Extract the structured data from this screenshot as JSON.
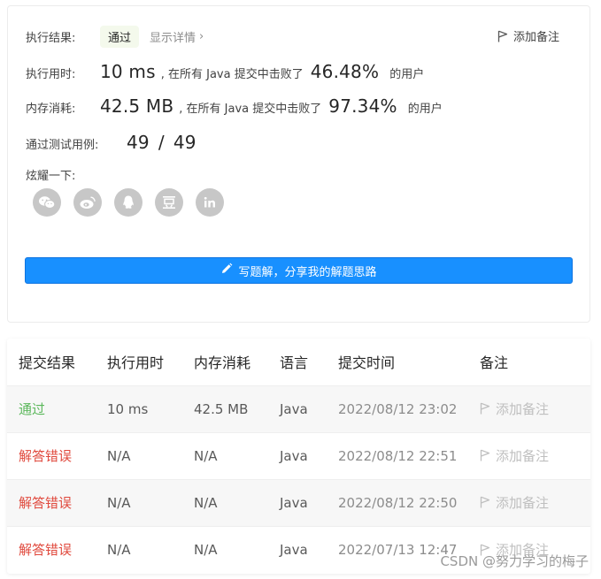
{
  "summary": {
    "result_label": "执行结果:",
    "result_value": "通过",
    "details_label": "显示详情",
    "details_chevron": "›",
    "add_note": "添加备注",
    "runtime": {
      "label": "执行用时:",
      "value": "10 ms",
      "mid": ", 在所有 Java 提交中击败了",
      "percent": "46.48%",
      "suffix": "的用户"
    },
    "memory": {
      "label": "内存消耗:",
      "value": "42.5 MB",
      "mid": ", 在所有 Java 提交中击败了",
      "percent": "97.34%",
      "suffix": "的用户"
    },
    "tests": {
      "label": "通过测试用例:",
      "passed": "49",
      "sep": "/",
      "total": "49"
    },
    "share_label": "炫耀一下:",
    "share_icons": [
      "wechat-icon",
      "weibo-icon",
      "qq-icon",
      "douban-icon",
      "linkedin-icon"
    ],
    "write_button": "写题解，分享我的解题思路"
  },
  "table": {
    "headers": [
      "提交结果",
      "执行用时",
      "内存消耗",
      "语言",
      "提交时间",
      "备注"
    ],
    "rows": [
      {
        "result": "通过",
        "status": "ok",
        "runtime": "10 ms",
        "memory": "42.5 MB",
        "lang": "Java",
        "time": "2022/08/12 23:02",
        "note": "添加备注"
      },
      {
        "result": "解答错误",
        "status": "err",
        "runtime": "N/A",
        "memory": "N/A",
        "lang": "Java",
        "time": "2022/08/12 22:51",
        "note": "添加备注"
      },
      {
        "result": "解答错误",
        "status": "err",
        "runtime": "N/A",
        "memory": "N/A",
        "lang": "Java",
        "time": "2022/08/12 22:50",
        "note": "添加备注"
      },
      {
        "result": "解答错误",
        "status": "err",
        "runtime": "N/A",
        "memory": "N/A",
        "lang": "Java",
        "time": "2022/07/13 12:47",
        "note": "添加备注"
      }
    ]
  },
  "watermark": "CSDN @努力学习的梅子",
  "colors": {
    "primary": "#1890ff",
    "pass": "#5cb85c",
    "error": "#e0493d",
    "muted": "#bfbfbf"
  }
}
